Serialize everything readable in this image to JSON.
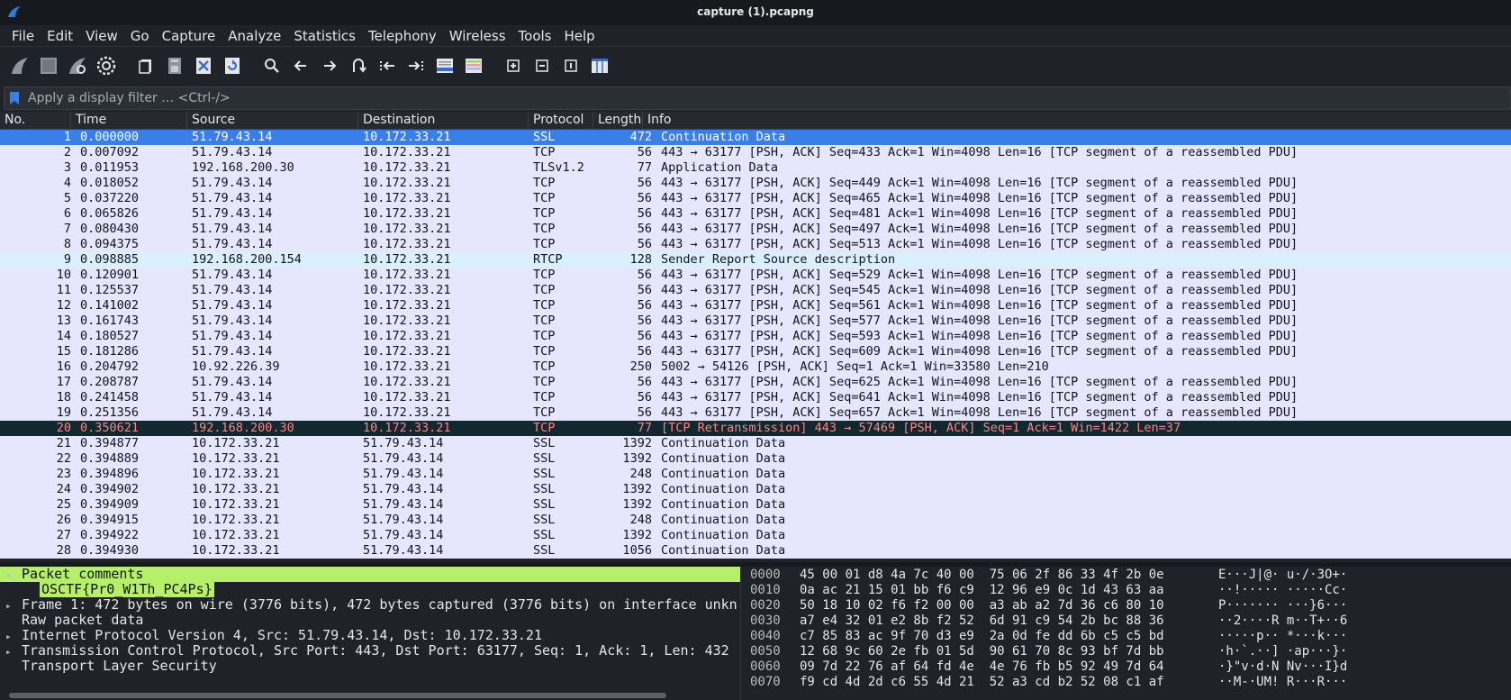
{
  "window": {
    "title": "capture (1).pcapng"
  },
  "menu": [
    "File",
    "Edit",
    "View",
    "Go",
    "Capture",
    "Analyze",
    "Statistics",
    "Telephony",
    "Wireless",
    "Tools",
    "Help"
  ],
  "toolbar_icons": [
    "shark-fin-start-icon",
    "stop-square-icon",
    "restart-fin-icon",
    "options-gear-icon",
    "open-file-icon",
    "save-file-icon",
    "close-file-icon",
    "reload-file-icon",
    "search-icon",
    "back-arrow-icon",
    "forward-arrow-icon",
    "goto-packet-icon",
    "first-packet-icon",
    "last-packet-icon",
    "autoscroll-icon",
    "colorize-icon",
    "zoom-in-icon",
    "zoom-out-icon",
    "normal-size-icon",
    "resize-columns-icon"
  ],
  "filter": {
    "placeholder": "Apply a display filter … <Ctrl-/>"
  },
  "columns": {
    "no": "No.",
    "time": "Time",
    "source": "Source",
    "destination": "Destination",
    "protocol": "Protocol",
    "length": "Length",
    "info": "Info"
  },
  "colors": {
    "selected_bg": "#3a7ee8",
    "tcp_bg": "#e7e6ff",
    "ssl_bg": "#e7e6ff",
    "tls_bg": "#e7e6ff",
    "rtcp_bg": "#dbf0ff",
    "retrans_bg": "#12272e",
    "retrans_fg": "#f78787",
    "row_fg": "#12131a",
    "comment_bg": "#b6f06a"
  },
  "packets": [
    {
      "no": "1",
      "time": "0.000000",
      "src": "51.79.43.14",
      "dst": "10.172.33.21",
      "proto": "SSL",
      "len": "472",
      "info": "Continuation Data",
      "style": "selected"
    },
    {
      "no": "2",
      "time": "0.007092",
      "src": "51.79.43.14",
      "dst": "10.172.33.21",
      "proto": "TCP",
      "len": "56",
      "info": "443 → 63177 [PSH, ACK] Seq=433 Ack=1 Win=4098 Len=16 [TCP segment of a reassembled PDU]",
      "style": "tcp"
    },
    {
      "no": "3",
      "time": "0.011953",
      "src": "192.168.200.30",
      "dst": "10.172.33.21",
      "proto": "TLSv1.2",
      "len": "77",
      "info": "Application Data",
      "style": "tls"
    },
    {
      "no": "4",
      "time": "0.018052",
      "src": "51.79.43.14",
      "dst": "10.172.33.21",
      "proto": "TCP",
      "len": "56",
      "info": "443 → 63177 [PSH, ACK] Seq=449 Ack=1 Win=4098 Len=16 [TCP segment of a reassembled PDU]",
      "style": "tcp"
    },
    {
      "no": "5",
      "time": "0.037220",
      "src": "51.79.43.14",
      "dst": "10.172.33.21",
      "proto": "TCP",
      "len": "56",
      "info": "443 → 63177 [PSH, ACK] Seq=465 Ack=1 Win=4098 Len=16 [TCP segment of a reassembled PDU]",
      "style": "tcp"
    },
    {
      "no": "6",
      "time": "0.065826",
      "src": "51.79.43.14",
      "dst": "10.172.33.21",
      "proto": "TCP",
      "len": "56",
      "info": "443 → 63177 [PSH, ACK] Seq=481 Ack=1 Win=4098 Len=16 [TCP segment of a reassembled PDU]",
      "style": "tcp"
    },
    {
      "no": "7",
      "time": "0.080430",
      "src": "51.79.43.14",
      "dst": "10.172.33.21",
      "proto": "TCP",
      "len": "56",
      "info": "443 → 63177 [PSH, ACK] Seq=497 Ack=1 Win=4098 Len=16 [TCP segment of a reassembled PDU]",
      "style": "tcp"
    },
    {
      "no": "8",
      "time": "0.094375",
      "src": "51.79.43.14",
      "dst": "10.172.33.21",
      "proto": "TCP",
      "len": "56",
      "info": "443 → 63177 [PSH, ACK] Seq=513 Ack=1 Win=4098 Len=16 [TCP segment of a reassembled PDU]",
      "style": "tcp"
    },
    {
      "no": "9",
      "time": "0.098885",
      "src": "192.168.200.154",
      "dst": "10.172.33.21",
      "proto": "RTCP",
      "len": "128",
      "info": "Sender Report   Source description",
      "style": "rtcp"
    },
    {
      "no": "10",
      "time": "0.120901",
      "src": "51.79.43.14",
      "dst": "10.172.33.21",
      "proto": "TCP",
      "len": "56",
      "info": "443 → 63177 [PSH, ACK] Seq=529 Ack=1 Win=4098 Len=16 [TCP segment of a reassembled PDU]",
      "style": "tcp"
    },
    {
      "no": "11",
      "time": "0.125537",
      "src": "51.79.43.14",
      "dst": "10.172.33.21",
      "proto": "TCP",
      "len": "56",
      "info": "443 → 63177 [PSH, ACK] Seq=545 Ack=1 Win=4098 Len=16 [TCP segment of a reassembled PDU]",
      "style": "tcp"
    },
    {
      "no": "12",
      "time": "0.141002",
      "src": "51.79.43.14",
      "dst": "10.172.33.21",
      "proto": "TCP",
      "len": "56",
      "info": "443 → 63177 [PSH, ACK] Seq=561 Ack=1 Win=4098 Len=16 [TCP segment of a reassembled PDU]",
      "style": "tcp"
    },
    {
      "no": "13",
      "time": "0.161743",
      "src": "51.79.43.14",
      "dst": "10.172.33.21",
      "proto": "TCP",
      "len": "56",
      "info": "443 → 63177 [PSH, ACK] Seq=577 Ack=1 Win=4098 Len=16 [TCP segment of a reassembled PDU]",
      "style": "tcp"
    },
    {
      "no": "14",
      "time": "0.180527",
      "src": "51.79.43.14",
      "dst": "10.172.33.21",
      "proto": "TCP",
      "len": "56",
      "info": "443 → 63177 [PSH, ACK] Seq=593 Ack=1 Win=4098 Len=16 [TCP segment of a reassembled PDU]",
      "style": "tcp"
    },
    {
      "no": "15",
      "time": "0.181286",
      "src": "51.79.43.14",
      "dst": "10.172.33.21",
      "proto": "TCP",
      "len": "56",
      "info": "443 → 63177 [PSH, ACK] Seq=609 Ack=1 Win=4098 Len=16 [TCP segment of a reassembled PDU]",
      "style": "tcp"
    },
    {
      "no": "16",
      "time": "0.204792",
      "src": "10.92.226.39",
      "dst": "10.172.33.21",
      "proto": "TCP",
      "len": "250",
      "info": "5002 → 54126 [PSH, ACK] Seq=1 Ack=1 Win=33580 Len=210",
      "style": "tcp"
    },
    {
      "no": "17",
      "time": "0.208787",
      "src": "51.79.43.14",
      "dst": "10.172.33.21",
      "proto": "TCP",
      "len": "56",
      "info": "443 → 63177 [PSH, ACK] Seq=625 Ack=1 Win=4098 Len=16 [TCP segment of a reassembled PDU]",
      "style": "tcp"
    },
    {
      "no": "18",
      "time": "0.241458",
      "src": "51.79.43.14",
      "dst": "10.172.33.21",
      "proto": "TCP",
      "len": "56",
      "info": "443 → 63177 [PSH, ACK] Seq=641 Ack=1 Win=4098 Len=16 [TCP segment of a reassembled PDU]",
      "style": "tcp"
    },
    {
      "no": "19",
      "time": "0.251356",
      "src": "51.79.43.14",
      "dst": "10.172.33.21",
      "proto": "TCP",
      "len": "56",
      "info": "443 → 63177 [PSH, ACK] Seq=657 Ack=1 Win=4098 Len=16 [TCP segment of a reassembled PDU]",
      "style": "tcp"
    },
    {
      "no": "20",
      "time": "0.350621",
      "src": "192.168.200.30",
      "dst": "10.172.33.21",
      "proto": "TCP",
      "len": "77",
      "info": "[TCP Retransmission] 443 → 57469 [PSH, ACK] Seq=1 Ack=1 Win=1422 Len=37",
      "style": "retrans"
    },
    {
      "no": "21",
      "time": "0.394877",
      "src": "10.172.33.21",
      "dst": "51.79.43.14",
      "proto": "SSL",
      "len": "1392",
      "info": "Continuation Data",
      "style": "ssl"
    },
    {
      "no": "22",
      "time": "0.394889",
      "src": "10.172.33.21",
      "dst": "51.79.43.14",
      "proto": "SSL",
      "len": "1392",
      "info": "Continuation Data",
      "style": "ssl"
    },
    {
      "no": "23",
      "time": "0.394896",
      "src": "10.172.33.21",
      "dst": "51.79.43.14",
      "proto": "SSL",
      "len": "248",
      "info": "Continuation Data",
      "style": "ssl"
    },
    {
      "no": "24",
      "time": "0.394902",
      "src": "10.172.33.21",
      "dst": "51.79.43.14",
      "proto": "SSL",
      "len": "1392",
      "info": "Continuation Data",
      "style": "ssl"
    },
    {
      "no": "25",
      "time": "0.394909",
      "src": "10.172.33.21",
      "dst": "51.79.43.14",
      "proto": "SSL",
      "len": "1392",
      "info": "Continuation Data",
      "style": "ssl"
    },
    {
      "no": "26",
      "time": "0.394915",
      "src": "10.172.33.21",
      "dst": "51.79.43.14",
      "proto": "SSL",
      "len": "248",
      "info": "Continuation Data",
      "style": "ssl"
    },
    {
      "no": "27",
      "time": "0.394922",
      "src": "10.172.33.21",
      "dst": "51.79.43.14",
      "proto": "SSL",
      "len": "1392",
      "info": "Continuation Data",
      "style": "ssl"
    },
    {
      "no": "28",
      "time": "0.394930",
      "src": "10.172.33.21",
      "dst": "51.79.43.14",
      "proto": "SSL",
      "len": "1056",
      "info": "Continuation Data",
      "style": "ssl"
    }
  ],
  "details": [
    {
      "text": "Packet comments",
      "arrow": "▾",
      "highlight": true
    },
    {
      "text": "OSCTF{Pr0_W1Th_PC4Ps}",
      "sub": true
    },
    {
      "text": "Frame 1: 472 bytes on wire (3776 bits), 472 bytes captured (3776 bits) on interface unkn",
      "arrow": "▸"
    },
    {
      "text": "Raw packet data",
      "arrow": ""
    },
    {
      "text": "Internet Protocol Version 4, Src: 51.79.43.14, Dst: 10.172.33.21",
      "arrow": "▸"
    },
    {
      "text": "Transmission Control Protocol, Src Port: 443, Dst Port: 63177, Seq: 1, Ack: 1, Len: 432",
      "arrow": "▸"
    },
    {
      "text": "Transport Layer Security",
      "arrow": ""
    }
  ],
  "bytes": [
    {
      "off": "0000",
      "hex": "45 00 01 d8 4a 7c 40 00  75 06 2f 86 33 4f 2b 0e",
      "asc": "E···J|@· u·/·3O+·"
    },
    {
      "off": "0010",
      "hex": "0a ac 21 15 01 bb f6 c9  12 96 e9 0c 1d 43 63 aa",
      "asc": "··!····· ·····Cc·"
    },
    {
      "off": "0020",
      "hex": "50 18 10 02 f6 f2 00 00  a3 ab a2 7d 36 c6 80 10",
      "asc": "P······· ···}6···"
    },
    {
      "off": "0030",
      "hex": "a7 e4 32 01 e2 8b f2 52  6d 91 c9 54 2b bc 88 36",
      "asc": "··2····R m··T+··6"
    },
    {
      "off": "0040",
      "hex": "c7 85 83 ac 9f 70 d3 e9  2a 0d fe dd 6b c5 c5 bd",
      "asc": "·····p·· *···k···"
    },
    {
      "off": "0050",
      "hex": "12 68 9c 60 2e fb 01 5d  90 61 70 8c 93 bf 7d bb",
      "asc": "·h·`.··] ·ap···}·"
    },
    {
      "off": "0060",
      "hex": "09 7d 22 76 af 64 fd 4e  4e 76 fb b5 92 49 7d 64",
      "asc": "·}\"v·d·N Nv···I}d"
    },
    {
      "off": "0070",
      "hex": "f9 cd 4d 2d c6 55 4d 21  52 a3 cd b2 52 08 c1 af",
      "asc": "··M-·UM! R···R···"
    }
  ]
}
